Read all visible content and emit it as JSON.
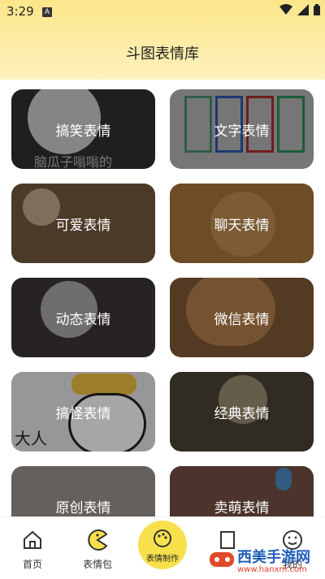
{
  "status": {
    "time": "3:29",
    "sim_badge": "A"
  },
  "header": {
    "title": "斗图表情库"
  },
  "cards": [
    {
      "label": "搞笑表情",
      "bg": "#3a3a3a",
      "caption": "脑瓜子嗡嗡的"
    },
    {
      "label": "文字表情",
      "bg": "#d8d8d8",
      "caption": ""
    },
    {
      "label": "可爱表情",
      "bg": "#8a6a4a",
      "caption": ""
    },
    {
      "label": "聊天表情",
      "bg": "#c68a4a",
      "caption": ""
    },
    {
      "label": "动态表情",
      "bg": "#4a4040",
      "caption": ""
    },
    {
      "label": "微信表情",
      "bg": "#9a6a40",
      "caption": ""
    },
    {
      "label": "搞怪表情",
      "bg": "#e8e8e8",
      "caption": "大人"
    },
    {
      "label": "经典表情",
      "bg": "#5a5040",
      "caption": ""
    },
    {
      "label": "原创表情",
      "bg": "#b8b0a8",
      "caption": ""
    },
    {
      "label": "卖萌表情",
      "bg": "#8a6050",
      "caption": ""
    }
  ],
  "nav": {
    "home": "首页",
    "pack": "表情包",
    "make": "表情制作",
    "tab4": "",
    "mine": "我的"
  },
  "watermark": {
    "name": "西美手游网",
    "url": "www.hanxm.com"
  }
}
